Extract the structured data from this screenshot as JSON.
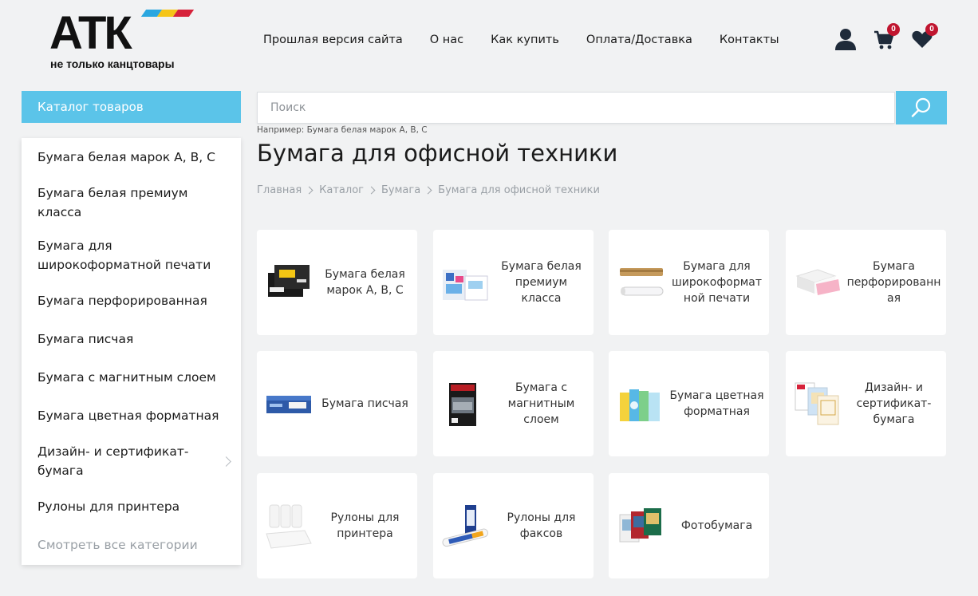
{
  "header": {
    "logo_text": "АТК",
    "logo_subtitle": "не только канцтовары",
    "nav": [
      "Прошлая версия сайта",
      "О нас",
      "Как купить",
      "Оплата/Доставка",
      "Контакты"
    ],
    "cart_count": "0",
    "favorites_count": "0"
  },
  "sidebar": {
    "catalog_label": "Каталог товаров",
    "items": [
      "Бумага белая марок A, B, C",
      "Бумага белая премиум класса",
      "Бумага для широкоформатной печати",
      "Бумага перфорированная",
      "Бумага писчая",
      "Бумага с магнитным слоем",
      "Бумага цветная форматная",
      "Дизайн- и сертификат-бумага",
      "Рулоны для принтера"
    ],
    "see_all": "Смотреть все категории"
  },
  "search": {
    "placeholder": "Поиск",
    "hint": "Например: Бумага белая марок A, B, C"
  },
  "page_title": "Бумага для офисной техники",
  "breadcrumbs": [
    "Главная",
    "Каталог",
    "Бумага",
    "Бумага для офисной техники"
  ],
  "categories": [
    "Бумага белая марок A, B, C",
    "Бумага белая премиум класса",
    "Бумага для широкоформатной печати",
    "Бумага перфорированная",
    "Бумага писчая",
    "Бумага с магнитным слоем",
    "Бумага цветная форматная",
    "Дизайн- и сертификат-бумага",
    "Рулоны для принтера",
    "Рулоны для факсов",
    "Фотобумага"
  ],
  "colors": {
    "accent": "#5bc4e9",
    "badge": "#c0152f",
    "background": "#f1f2f3"
  }
}
